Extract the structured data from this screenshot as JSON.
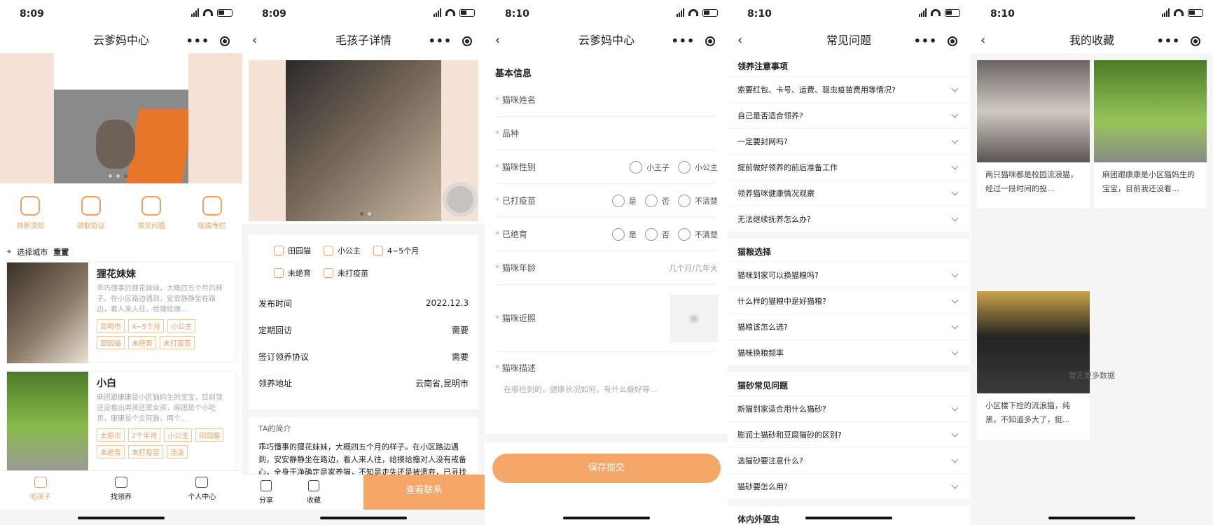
{
  "colors": {
    "accent": "#f0a061",
    "button": "#f5a76a"
  },
  "s1": {
    "time": "8:09",
    "title": "云爹妈中心",
    "quick": [
      "领养须知",
      "领取协议",
      "常见问题",
      "吸猫专栏"
    ],
    "city_label": "选择城市",
    "city": "重置",
    "cards": [
      {
        "name": "狸花妹妹",
        "desc": "乖巧懂事的狸花妹妹，大概四五个月的样子。在小区路边遇到，安安静静坐在路边，看人来人往，给摸给撸...",
        "tags": [
          "昆明市",
          "4~5个月",
          "小公主",
          "田园猫",
          "未绝育",
          "未打疫苗"
        ]
      },
      {
        "name": "小白",
        "desc": "麻团跟康康是小区猫妈生的宝宝，目前我还没看出男孩还是女孩，麻团是个小吃货，康康是个交际猫，两个...",
        "tags": [
          "太原市",
          "2个半月",
          "小公主",
          "田园猫",
          "未绝育",
          "未打疫苗",
          "活泼"
        ]
      }
    ],
    "tabs": [
      "毛孩子",
      "找领养",
      "个人中心"
    ]
  },
  "s2": {
    "time": "8:09",
    "title": "毛孩子详情",
    "attrs1": [
      "田园猫",
      "小公主",
      "4~5个月"
    ],
    "attrs2": [
      "未绝育",
      "未打疫苗"
    ],
    "kv": [
      {
        "k": "发布时间",
        "v": "2022.12.3"
      },
      {
        "k": "定期回访",
        "v": "需要"
      },
      {
        "k": "签订领养协议",
        "v": "需要"
      },
      {
        "k": "领养地址",
        "v": "云南省,昆明市"
      }
    ],
    "intro_title": "TA的简介",
    "intro": "乖巧懂事的狸花妹妹，大概四五个月的样子。在小区路边遇到，安安静静坐在路边，看人来人往，给摸给撸对人没有戒备心，全身干净确定是家养猫，不知是走失还是被遗弃，已寻找",
    "share": "分享",
    "fav": "收藏",
    "contact": "查看联系"
  },
  "s3": {
    "time": "8:10",
    "title": "云爹妈中心",
    "section": "基本信息",
    "name": "猫咪姓名",
    "breed": "品种",
    "gender": "猫咪性别",
    "g1": "小王子",
    "g2": "小公主",
    "vaccine": "已打疫苗",
    "sterile": "已绝育",
    "yes": "是",
    "no": "否",
    "unknown": "不清楚",
    "age": "猫咪年龄",
    "age_ph": "几个月/几年大",
    "photo": "猫咪近照",
    "desc": "猫咪描述",
    "desc_ph": "在哪捡到的，健康状况如何，有什么癖好等...",
    "save": "保存提交"
  },
  "s4": {
    "time": "8:10",
    "title": "常见问题",
    "sections": [
      {
        "title": "领养注意事项",
        "items": [
          "索要红包、卡号、运费、驱虫疫苗费用等情况?",
          "自己是否适合领养?",
          "一定要封网吗?",
          "提前做好领养的前后准备工作",
          "领养猫咪健康情况观察",
          "无法继续抚养怎么办?"
        ]
      },
      {
        "title": "猫粮选择",
        "items": [
          "猫咪到家可以换猫粮吗?",
          "什么样的猫粮中是好猫粮?",
          "猫粮该怎么选?",
          "猫咪换粮频率"
        ]
      },
      {
        "title": "猫砂常见问题",
        "items": [
          "新猫到家适合用什么猫砂?",
          "膨润土猫砂和豆腐猫砂的区别?",
          "选猫砂要注意什么?",
          "猫砂要怎么用?"
        ]
      },
      {
        "title": "体内外驱虫",
        "items": []
      }
    ]
  },
  "s5": {
    "time": "8:10",
    "title": "我的收藏",
    "favs": [
      "两只猫咪都是校园流浪猫，经过一段时间的投...",
      "麻团跟康康是小区猫妈生的宝宝，目前我还没看...",
      "小区楼下捡的流浪猫，纯黑，不知道多大了，挺..."
    ],
    "nomore": "暂无更多数据"
  }
}
